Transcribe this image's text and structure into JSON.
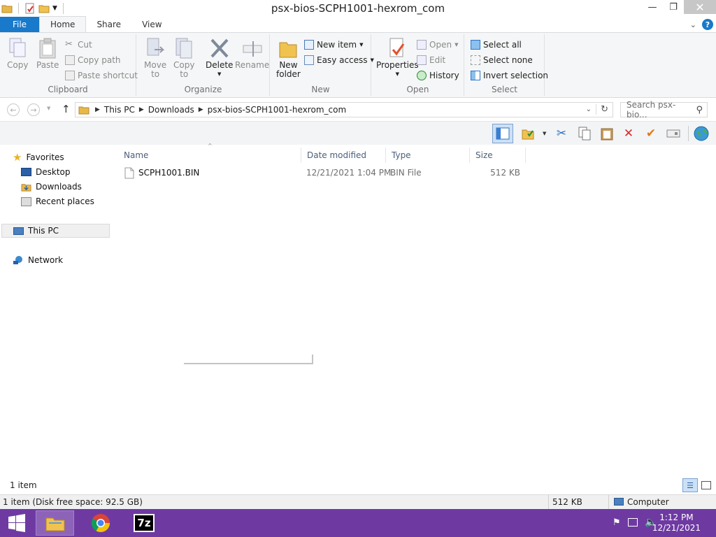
{
  "window": {
    "title": "psx-bios-SCPH1001-hexrom_com",
    "minimize": "—",
    "maximize": "❐",
    "close": "✕"
  },
  "ribbon_tabs": [
    "File",
    "Home",
    "Share",
    "View"
  ],
  "ribbon": {
    "clipboard": {
      "label": "Clipboard",
      "copy": "Copy",
      "paste": "Paste",
      "cut": "Cut",
      "copy_path": "Copy path",
      "paste_shortcut": "Paste shortcut"
    },
    "organize": {
      "label": "Organize",
      "move_to": [
        "Move",
        "to"
      ],
      "copy_to": [
        "Copy",
        "to"
      ],
      "delete": "Delete",
      "rename": "Rename"
    },
    "new": {
      "label": "New",
      "new_folder": [
        "New",
        "folder"
      ],
      "new_item": "New item",
      "easy_access": "Easy access"
    },
    "open": {
      "label": "Open",
      "properties": "Properties",
      "open": "Open",
      "edit": "Edit",
      "history": "History"
    },
    "select": {
      "label": "Select",
      "select_all": "Select all",
      "select_none": "Select none",
      "invert_selection": "Invert selection"
    }
  },
  "address": {
    "crumbs": [
      "This PC",
      "Downloads",
      "psx-bios-SCPH1001-hexrom_com"
    ],
    "search_placeholder": "Search psx-bio..."
  },
  "nav": {
    "favorites": "Favorites",
    "desktop": "Desktop",
    "downloads": "Downloads",
    "recent_places": "Recent places",
    "this_pc": "This PC",
    "network": "Network"
  },
  "columns": {
    "name": "Name",
    "date_modified": "Date modified",
    "type": "Type",
    "size": "Size"
  },
  "files": [
    {
      "name": "SCPH1001.BIN",
      "date_modified": "12/21/2021 1:04 PM",
      "type": "BIN File",
      "size": "512 KB"
    }
  ],
  "status": {
    "item_count": "1 item",
    "detail": "1 item (Disk free space: 92.5 GB)",
    "size": "512 KB",
    "location": "Computer"
  },
  "taskbar": {
    "time": "1:12 PM",
    "date": "12/21/2021",
    "seven_zip": "7z"
  },
  "colors": {
    "accent": "#1979ca",
    "taskbar": "#6e3aa2",
    "ribbon_bg": "#f5f6f7"
  }
}
